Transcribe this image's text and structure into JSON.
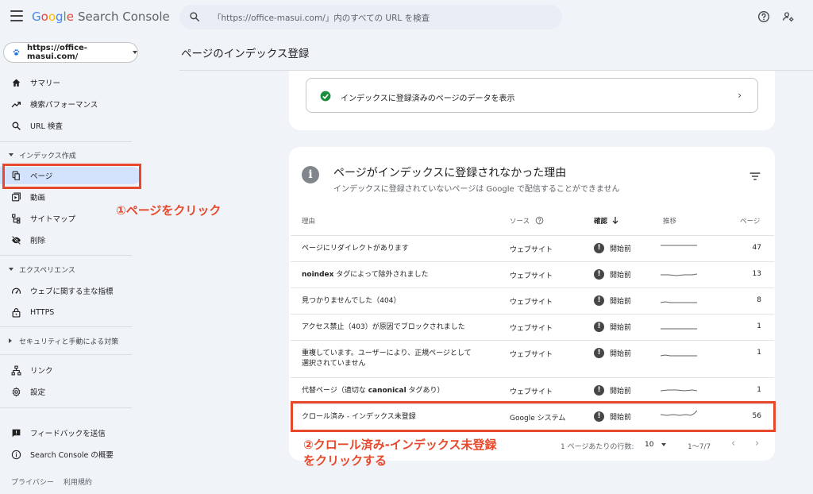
{
  "header": {
    "logo_google": "Google",
    "logo_product": "Search Console",
    "search_placeholder": "「https://office-masui.com/」内のすべての URL を検査"
  },
  "sidebar": {
    "property": "https://office-masui.com/",
    "items_top": [
      {
        "label": "サマリー",
        "icon": "home-icon"
      },
      {
        "label": "検索パフォーマンス",
        "icon": "trending-up-icon"
      },
      {
        "label": "URL 検査",
        "icon": "search-icon"
      }
    ],
    "section_index": "インデックス作成",
    "items_index": [
      {
        "label": "ページ",
        "icon": "pages-icon"
      },
      {
        "label": "動画",
        "icon": "video-icon"
      },
      {
        "label": "サイトマップ",
        "icon": "sitemap-icon"
      },
      {
        "label": "削除",
        "icon": "visibility-off-icon"
      }
    ],
    "section_experience": "エクスペリエンス",
    "items_experience": [
      {
        "label": "ウェブに関する主な指標",
        "icon": "speed-icon"
      },
      {
        "label": "HTTPS",
        "icon": "lock-icon"
      }
    ],
    "section_security": "セキュリティと手動による対策",
    "items_bottom": [
      {
        "label": "リンク",
        "icon": "links-icon"
      },
      {
        "label": "設定",
        "icon": "settings-icon"
      }
    ],
    "items_footer": [
      {
        "label": "フィードバックを送信",
        "icon": "feedback-icon"
      },
      {
        "label": "Search Console の概要",
        "icon": "info-icon"
      }
    ],
    "footer_links": [
      "プライバシー",
      "利用規約"
    ]
  },
  "main": {
    "page_title": "ページのインデックス登録",
    "summary_link": "インデックスに登録済みのページのデータを表示",
    "card_title": "ページがインデックスに登録されなかった理由",
    "card_subtitle": "インデックスに登録されていないページは Google で配信することができません",
    "columns": {
      "reason": "理由",
      "source": "ソース",
      "validation": "確認",
      "trend": "推移",
      "pages": "ページ"
    },
    "rows": [
      {
        "reason": "ページにリダイレクトがあります",
        "source": "ウェブサイト",
        "status": "開始前",
        "pages": "47"
      },
      {
        "reason_bold": "noindex",
        "reason": " タグによって除外されました",
        "source": "ウェブサイト",
        "status": "開始前",
        "pages": "13"
      },
      {
        "reason": "見つかりませんでした（404）",
        "source": "ウェブサイト",
        "status": "開始前",
        "pages": "8"
      },
      {
        "reason": "アクセス禁止（403）が原因でブロックされました",
        "source": "ウェブサイト",
        "status": "開始前",
        "pages": "1"
      },
      {
        "reason": "重複しています。ユーザーにより、正規ページとして",
        "reason_line2": "選択されていません",
        "source": "ウェブサイト",
        "status": "開始前",
        "pages": "1"
      },
      {
        "reason": "代替ページ（適切な ",
        "reason_bold": "canonical",
        "reason_after": " タグあり）",
        "source": "ウェブサイト",
        "status": "開始前",
        "pages": "1"
      },
      {
        "reason": "クロール済み - インデックス未登録",
        "source": "Google システム",
        "status": "開始前",
        "pages": "56"
      }
    ],
    "pager": {
      "rows_label": "1 ページあたりの行数:",
      "rows_value": "10",
      "range": "1〜7/7"
    }
  },
  "annotations": {
    "step1": "①ページをクリック",
    "step2_line1": "②クロール済み-インデックス未登録",
    "step2_line2": "をクリックする"
  },
  "colors": {
    "accent_red": "#e8482b",
    "active_nav": "#d3e3fd",
    "success_green": "#1e8e3e"
  }
}
